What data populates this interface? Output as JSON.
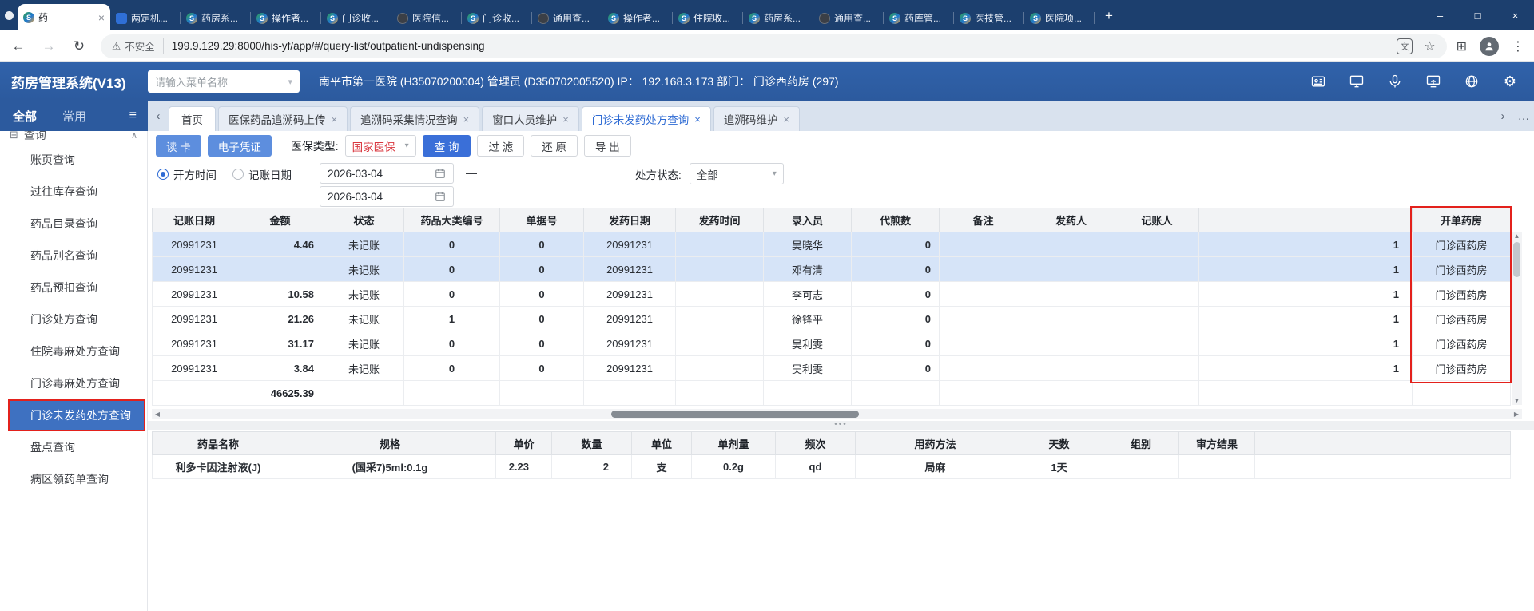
{
  "icons": {
    "logo_s": "S",
    "close": "×",
    "chevron_down": "▾",
    "chevron_up": "∧",
    "back": "←",
    "forward": "→",
    "refresh": "↻",
    "warning": "⚠",
    "star": "☆",
    "menu_dots": "⋮",
    "more": "…",
    "tab_left": "‹",
    "tab_right": "›",
    "scroll_up": "▲",
    "scroll_down": "▼",
    "scroll_left": "◀",
    "scroll_right": "▶",
    "burger": "≡",
    "plus": "+",
    "minimize": "–",
    "maximize": "□",
    "extensions": "⊞",
    "translate": "文",
    "grid": "⊟",
    "dots3": "•••",
    "gear": "⚙"
  },
  "browser": {
    "tabs": [
      {
        "label": "药",
        "icon": "s-logo",
        "active": true
      },
      {
        "label": "两定机...",
        "icon": "blue-app",
        "active": false
      },
      {
        "label": "药房系...",
        "icon": "s-logo",
        "active": false
      },
      {
        "label": "操作者...",
        "icon": "s-logo",
        "active": false
      },
      {
        "label": "门诊收...",
        "icon": "s-logo",
        "active": false
      },
      {
        "label": "医院信...",
        "icon": "dark-globe",
        "active": false
      },
      {
        "label": "门诊收...",
        "icon": "s-logo",
        "active": false
      },
      {
        "label": "通用查...",
        "icon": "dark-globe",
        "active": false
      },
      {
        "label": "操作者...",
        "icon": "s-logo",
        "active": false
      },
      {
        "label": "住院收...",
        "icon": "s-logo",
        "active": false
      },
      {
        "label": "药房系...",
        "icon": "s-logo",
        "active": false
      },
      {
        "label": "通用查...",
        "icon": "dark-globe",
        "active": false
      },
      {
        "label": "药库管...",
        "icon": "s-logo",
        "active": false
      },
      {
        "label": "医技管...",
        "icon": "s-logo",
        "active": false
      },
      {
        "label": "医院项...",
        "icon": "s-logo",
        "active": false
      }
    ],
    "security_text": "不安全",
    "url": "199.9.129.29:8000/his-yf/app/#/query-list/outpatient-undispensing"
  },
  "app_header": {
    "title": "药房管理系统(V13)",
    "menu_search_placeholder": "请输入菜单名称",
    "info": "南平市第一医院 (H35070200004) 管理员 (D350702005520) IP： 192.168.3.173 部门： 门诊西药房 (297)"
  },
  "sidebar": {
    "tabs": [
      {
        "label": "全部",
        "active": true
      },
      {
        "label": "常用",
        "active": false
      }
    ],
    "group_label": "查询",
    "items": [
      {
        "label": "账页查询",
        "selected": false
      },
      {
        "label": "过往库存查询",
        "selected": false
      },
      {
        "label": "药品目录查询",
        "selected": false
      },
      {
        "label": "药品别名查询",
        "selected": false
      },
      {
        "label": "药品预扣查询",
        "selected": false
      },
      {
        "label": "门诊处方查询",
        "selected": false
      },
      {
        "label": "住院毒麻处方查询",
        "selected": false
      },
      {
        "label": "门诊毒麻处方查询",
        "selected": false
      },
      {
        "label": "门诊未发药处方查询",
        "selected": true
      },
      {
        "label": "盘点查询",
        "selected": false
      },
      {
        "label": "病区领药单查询",
        "selected": false
      }
    ]
  },
  "tabbar": {
    "tabs": [
      {
        "label": "首页",
        "closable": false,
        "active": false
      },
      {
        "label": "医保药品追溯码上传",
        "closable": true,
        "active": false
      },
      {
        "label": "追溯码采集情况查询",
        "closable": true,
        "active": false
      },
      {
        "label": "窗口人员维护",
        "closable": true,
        "active": false
      },
      {
        "label": "门诊未发药处方查询",
        "closable": true,
        "active": true
      },
      {
        "label": "追溯码维护",
        "closable": true,
        "active": false
      }
    ]
  },
  "toolbar": {
    "read_card": "读 卡",
    "e_voucher": "电子凭证",
    "insurance_label": "医保类型:",
    "insurance_value": "国家医保",
    "query": "查 询",
    "filter": "过 滤",
    "reset": "还 原",
    "export": "导 出"
  },
  "filters": {
    "radio_open_time": "开方时间",
    "radio_billing_date": "记账日期",
    "date_from": "2026-03-04",
    "date_to": "2026-03-04",
    "range_separator": "—",
    "status_label": "处方状态:",
    "status_value": "全部"
  },
  "main_table": {
    "columns": [
      "记账日期",
      "金额",
      "状态",
      "药品大类编号",
      "单据号",
      "发药日期",
      "发药时间",
      "录入员",
      "代煎数",
      "备注",
      "发药人",
      "记账人",
      "",
      "开单药房"
    ],
    "rows": [
      {
        "cells": [
          "20991231",
          "4.46",
          "未记账",
          "0",
          "0",
          "20991231",
          "",
          "吴晓华",
          "0",
          "",
          "",
          "",
          "1",
          "门诊西药房"
        ],
        "selected": true
      },
      {
        "cells": [
          "20991231",
          "",
          "未记账",
          "0",
          "0",
          "20991231",
          "",
          "邓有清",
          "0",
          "",
          "",
          "",
          "1",
          "门诊西药房"
        ],
        "selected": true
      },
      {
        "cells": [
          "20991231",
          "10.58",
          "未记账",
          "0",
          "0",
          "20991231",
          "",
          "李可志",
          "0",
          "",
          "",
          "",
          "1",
          "门诊西药房"
        ],
        "selected": false
      },
      {
        "cells": [
          "20991231",
          "21.26",
          "未记账",
          "1",
          "0",
          "20991231",
          "",
          "徐锋平",
          "0",
          "",
          "",
          "",
          "1",
          "门诊西药房"
        ],
        "selected": false
      },
      {
        "cells": [
          "20991231",
          "31.17",
          "未记账",
          "0",
          "0",
          "20991231",
          "",
          "吴利雯",
          "0",
          "",
          "",
          "",
          "1",
          "门诊西药房"
        ],
        "selected": false
      },
      {
        "cells": [
          "20991231",
          "3.84",
          "未记账",
          "0",
          "0",
          "20991231",
          "",
          "吴利雯",
          "0",
          "",
          "",
          "",
          "1",
          "门诊西药房"
        ],
        "selected": false
      }
    ],
    "total_amount": "46625.39"
  },
  "detail_table": {
    "columns": [
      "药品名称",
      "规格",
      "单价",
      "数量",
      "单位",
      "单剂量",
      "频次",
      "用药方法",
      "天数",
      "组别",
      "审方结果"
    ],
    "rows": [
      [
        "利多卡因注射液(J)",
        "(国采7)5ml:0.1g",
        "2.23",
        "2",
        "支",
        "0.2g",
        "qd",
        "局麻",
        "1天",
        "",
        ""
      ]
    ]
  }
}
